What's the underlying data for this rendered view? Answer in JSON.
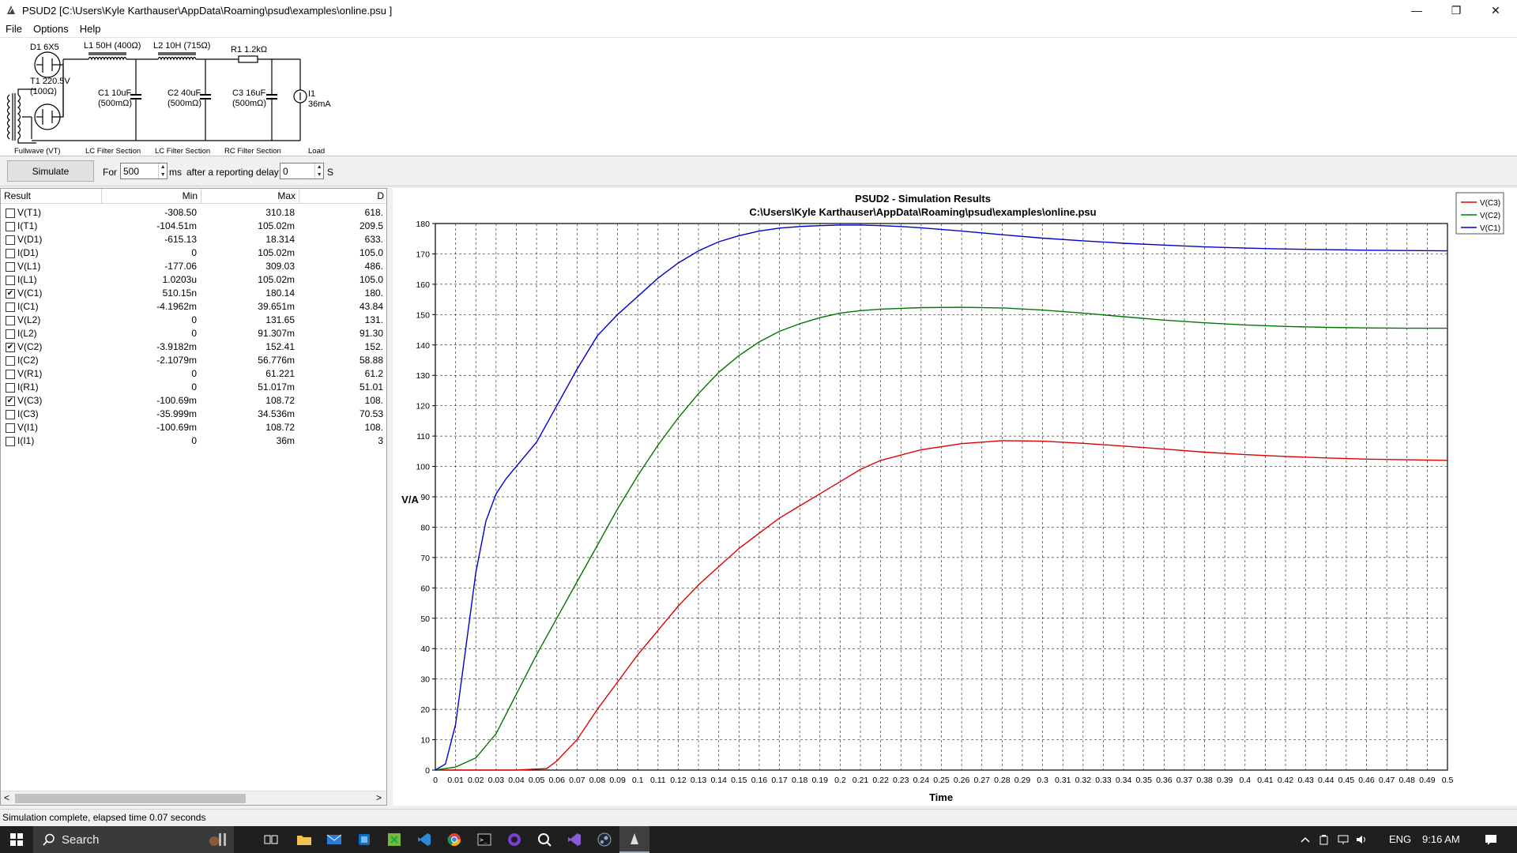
{
  "window": {
    "title": "PSUD2  [C:\\Users\\Kyle Karthauser\\AppData\\Roaming\\psud\\examples\\online.psu ]",
    "minimize": "—",
    "maximize": "❐",
    "close": "✕"
  },
  "menu": {
    "items": [
      "File",
      "Options",
      "Help"
    ]
  },
  "schematic": {
    "d1": "D1 6X5",
    "l1": "L1 50H (400Ω)",
    "l2": "L2 10H (715Ω)",
    "r1": "R1 1.2kΩ",
    "t1_a": "T1 220.5V",
    "t1_b": "(100Ω)",
    "c1_a": "C1 10uF",
    "c1_b": "(500mΩ)",
    "c2_a": "C2 40uF",
    "c2_b": "(500mΩ)",
    "c3_a": "C3 16uF",
    "c3_b": "(500mΩ)",
    "i1_a": "I1",
    "i1_b": "36mA",
    "sections": [
      "Fullwave (VT)",
      "LC Filter Section",
      "LC Filter Section",
      "RC Filter Section",
      "Load"
    ]
  },
  "simbar": {
    "simulate_label": "Simulate",
    "for_label": "For",
    "duration_value": "500",
    "ms_label": "ms",
    "delay_label": "after a reporting delay of",
    "delay_value": "0",
    "s_label": "S"
  },
  "results": {
    "headers": [
      "Result",
      "Min",
      "Max",
      "D"
    ],
    "rows": [
      {
        "name": "V(T1)",
        "checked": false,
        "min": "-308.50",
        "max": "310.18",
        "d": "618."
      },
      {
        "name": "I(T1)",
        "checked": false,
        "min": "-104.51m",
        "max": "105.02m",
        "d": "209.5"
      },
      {
        "name": "V(D1)",
        "checked": false,
        "min": "-615.13",
        "max": "18.314",
        "d": "633."
      },
      {
        "name": "I(D1)",
        "checked": false,
        "min": "0",
        "max": "105.02m",
        "d": "105.0"
      },
      {
        "name": "V(L1)",
        "checked": false,
        "min": "-177.06",
        "max": "309.03",
        "d": "486."
      },
      {
        "name": "I(L1)",
        "checked": false,
        "min": "1.0203u",
        "max": "105.02m",
        "d": "105.0"
      },
      {
        "name": "V(C1)",
        "checked": true,
        "min": "510.15n",
        "max": "180.14",
        "d": "180."
      },
      {
        "name": "I(C1)",
        "checked": false,
        "min": "-4.1962m",
        "max": "39.651m",
        "d": "43.84"
      },
      {
        "name": "V(L2)",
        "checked": false,
        "min": "0",
        "max": "131.65",
        "d": "131."
      },
      {
        "name": "I(L2)",
        "checked": false,
        "min": "0",
        "max": "91.307m",
        "d": "91.30"
      },
      {
        "name": "V(C2)",
        "checked": true,
        "min": "-3.9182m",
        "max": "152.41",
        "d": "152."
      },
      {
        "name": "I(C2)",
        "checked": false,
        "min": "-2.1079m",
        "max": "56.776m",
        "d": "58.88"
      },
      {
        "name": "V(R1)",
        "checked": false,
        "min": "0",
        "max": "61.221",
        "d": "61.2"
      },
      {
        "name": "I(R1)",
        "checked": false,
        "min": "0",
        "max": "51.017m",
        "d": "51.01"
      },
      {
        "name": "V(C3)",
        "checked": true,
        "min": "-100.69m",
        "max": "108.72",
        "d": "108."
      },
      {
        "name": "I(C3)",
        "checked": false,
        "min": "-35.999m",
        "max": "34.536m",
        "d": "70.53"
      },
      {
        "name": "V(I1)",
        "checked": false,
        "min": "-100.69m",
        "max": "108.72",
        "d": "108."
      },
      {
        "name": "I(I1)",
        "checked": false,
        "min": "0",
        "max": "36m",
        "d": "3"
      }
    ],
    "scroll_left": "<",
    "scroll_right": ">"
  },
  "colors": {
    "v_c1": "#0000cc",
    "v_c2": "#007700",
    "v_c3": "#dd0000"
  },
  "chart_data": {
    "type": "line",
    "title": "PSUD2 - Simulation Results",
    "subtitle": "C:\\Users\\Kyle Karthauser\\AppData\\Roaming\\psud\\examples\\online.psu",
    "xlabel": "Time",
    "ylabel": "V/A",
    "xlim": [
      0,
      0.5
    ],
    "ylim": [
      0,
      180
    ],
    "xticks": [
      0,
      0.01,
      0.02,
      0.03,
      0.04,
      0.05,
      0.06,
      0.07,
      0.08,
      0.09,
      0.1,
      0.11,
      0.12,
      0.13,
      0.14,
      0.15,
      0.16,
      0.17,
      0.18,
      0.19,
      0.2,
      0.21,
      0.22,
      0.23,
      0.24,
      0.25,
      0.26,
      0.27,
      0.28,
      0.29,
      0.3,
      0.31,
      0.32,
      0.33,
      0.34,
      0.35,
      0.36,
      0.37,
      0.38,
      0.39,
      0.4,
      0.41,
      0.42,
      0.43,
      0.44,
      0.45,
      0.46,
      0.47,
      0.48,
      0.49,
      0.5
    ],
    "yticks": [
      0,
      10,
      20,
      30,
      40,
      50,
      60,
      70,
      80,
      90,
      100,
      110,
      120,
      130,
      140,
      150,
      160,
      170,
      180
    ],
    "grid": true,
    "legend_position": "top-right",
    "series": [
      {
        "name": "V(C3)",
        "color": "#dd0000",
        "x": [
          0,
          0.02,
          0.04,
          0.055,
          0.06,
          0.07,
          0.08,
          0.09,
          0.1,
          0.11,
          0.12,
          0.13,
          0.14,
          0.15,
          0.16,
          0.17,
          0.18,
          0.19,
          0.2,
          0.21,
          0.22,
          0.24,
          0.26,
          0.28,
          0.3,
          0.32,
          0.34,
          0.36,
          0.38,
          0.4,
          0.42,
          0.44,
          0.46,
          0.48,
          0.5
        ],
        "y": [
          0,
          0,
          0,
          0.5,
          3,
          10,
          20,
          29,
          38,
          46,
          54,
          61,
          67,
          73,
          78,
          83,
          87,
          91,
          95,
          99,
          102,
          105.5,
          107.5,
          108.5,
          108.3,
          107.6,
          106.7,
          105.7,
          104.7,
          103.9,
          103.3,
          102.8,
          102.4,
          102.2,
          102
        ]
      },
      {
        "name": "V(C2)",
        "color": "#007700",
        "x": [
          0,
          0.01,
          0.02,
          0.03,
          0.04,
          0.05,
          0.06,
          0.07,
          0.08,
          0.09,
          0.1,
          0.11,
          0.12,
          0.13,
          0.14,
          0.15,
          0.16,
          0.17,
          0.18,
          0.19,
          0.2,
          0.21,
          0.22,
          0.24,
          0.26,
          0.28,
          0.3,
          0.32,
          0.34,
          0.36,
          0.38,
          0.4,
          0.42,
          0.44,
          0.46,
          0.48,
          0.5
        ],
        "y": [
          0,
          1,
          4,
          12,
          25,
          38,
          50,
          62,
          74,
          86,
          97,
          107,
          116,
          124,
          131,
          136.5,
          141,
          144.5,
          147,
          149,
          150.5,
          151.3,
          151.8,
          152.3,
          152.4,
          152.2,
          151.5,
          150.5,
          149.3,
          148.2,
          147.3,
          146.6,
          146.1,
          145.8,
          145.6,
          145.5,
          145.5
        ]
      },
      {
        "name": "V(C1)",
        "color": "#0000cc",
        "x": [
          0,
          0.005,
          0.01,
          0.015,
          0.02,
          0.025,
          0.03,
          0.035,
          0.04,
          0.05,
          0.06,
          0.07,
          0.08,
          0.09,
          0.1,
          0.11,
          0.12,
          0.13,
          0.14,
          0.15,
          0.16,
          0.17,
          0.18,
          0.19,
          0.2,
          0.21,
          0.22,
          0.23,
          0.24,
          0.26,
          0.28,
          0.3,
          0.32,
          0.34,
          0.36,
          0.38,
          0.4,
          0.42,
          0.44,
          0.46,
          0.48,
          0.5
        ],
        "y": [
          0,
          2,
          15,
          40,
          65,
          82,
          91,
          96,
          100,
          108,
          120,
          132,
          143,
          150,
          156,
          162,
          167,
          171,
          174,
          176,
          177.5,
          178.5,
          179,
          179.3,
          179.5,
          179.5,
          179.3,
          179,
          178.6,
          177.5,
          176.3,
          175.2,
          174.3,
          173.5,
          172.9,
          172.3,
          171.9,
          171.6,
          171.4,
          171.2,
          171.1,
          171
        ]
      }
    ]
  },
  "status": {
    "text": "Simulation complete, elapsed time 0.07 seconds"
  },
  "taskbar": {
    "search_placeholder": "Search",
    "lang": "ENG",
    "time": "9:16 AM"
  }
}
